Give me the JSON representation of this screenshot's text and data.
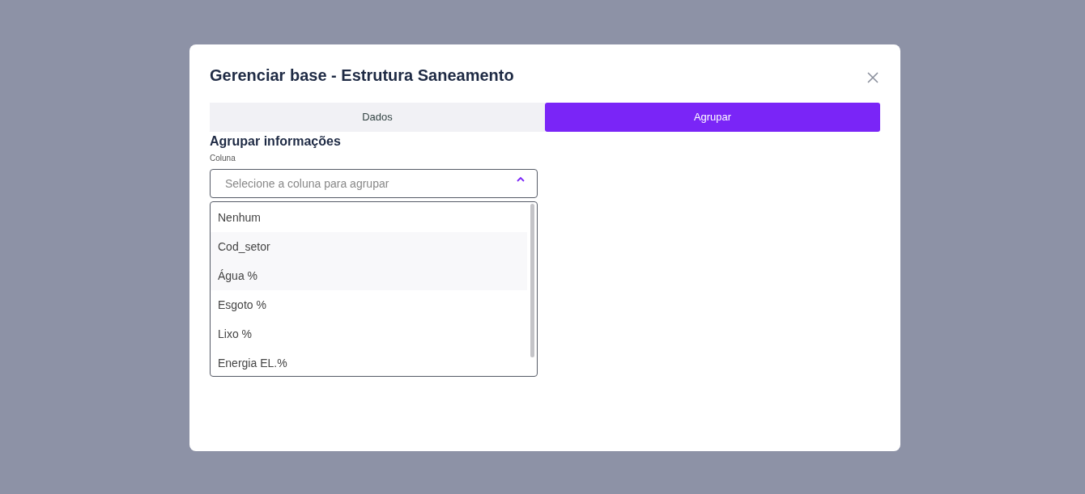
{
  "modal": {
    "title": "Gerenciar base - Estrutura Saneamento",
    "tabs": [
      {
        "label": "Dados",
        "selected": false
      },
      {
        "label": "Agrupar",
        "selected": true
      }
    ],
    "section_title": "Agrupar informações",
    "field": {
      "label": "Coluna",
      "placeholder": "Selecione a coluna para agrupar",
      "expanded": true
    },
    "options": [
      {
        "label": "Nenhum",
        "highlighted": false
      },
      {
        "label": "Cod_setor",
        "highlighted": true
      },
      {
        "label": "Água %",
        "highlighted": true
      },
      {
        "label": "Esgoto %",
        "highlighted": false
      },
      {
        "label": "Lixo %",
        "highlighted": false
      },
      {
        "label": "Energia EL.%",
        "highlighted": false
      }
    ]
  }
}
